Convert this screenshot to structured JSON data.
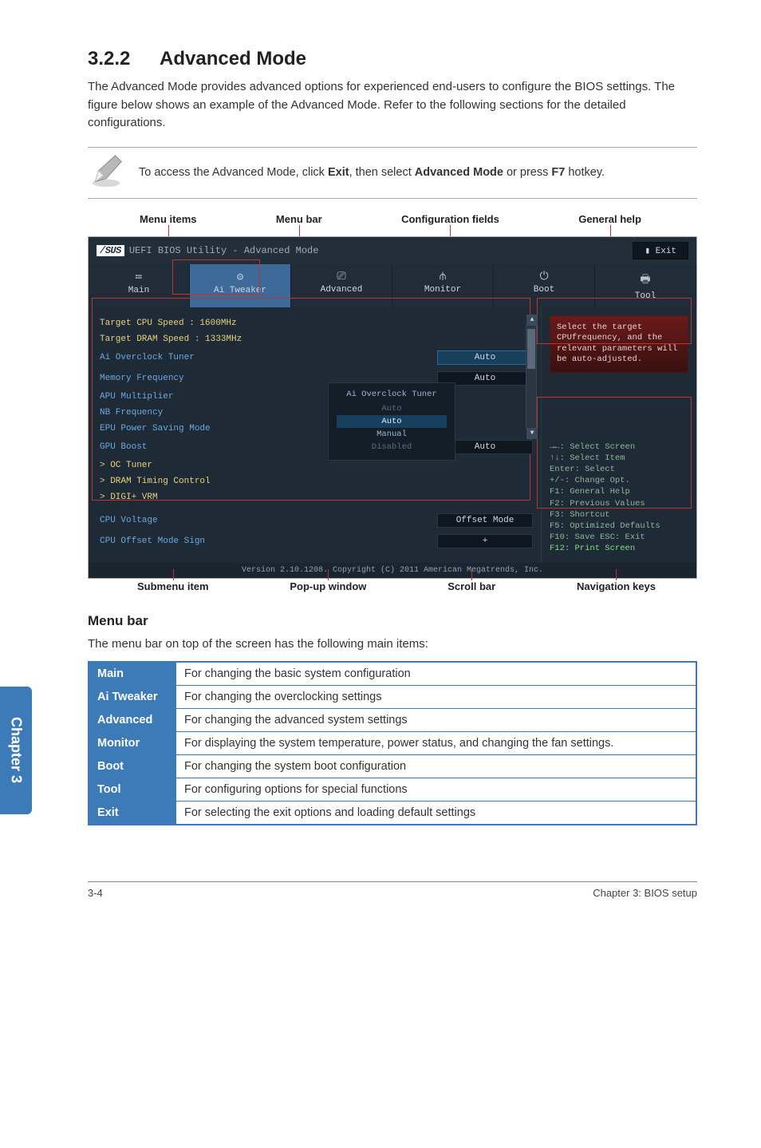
{
  "doc": {
    "section_number": "3.2.2",
    "section_title": "Advanced Mode",
    "intro": "The Advanced Mode provides advanced options for experienced end-users to configure the BIOS settings. The figure below shows an example of the Advanced Mode. Refer to the following sections for the detailed configurations.",
    "note_prefix": "To access the Advanced Mode, click ",
    "note_b1": "Exit",
    "note_mid": ", then select ",
    "note_b2": "Advanced Mode",
    "note_mid2": " or press ",
    "note_b3": "F7",
    "note_suffix": " hotkey."
  },
  "callouts_top": {
    "a": "Menu items",
    "b": "Menu bar",
    "c": "Configuration fields",
    "d": "General help"
  },
  "callouts_bottom": {
    "a": "Submenu item",
    "b": "Pop-up window",
    "c": "Scroll bar",
    "d": "Navigation keys"
  },
  "bios": {
    "logo": "/SUS",
    "title": "UEFI BIOS Utility - Advanced Mode",
    "exit": "Exit",
    "tabs": {
      "main": {
        "icon": "≔",
        "label": "Main"
      },
      "tweaker": {
        "icon": "⚙",
        "label": "Ai Tweaker"
      },
      "advanced": {
        "icon": "⎚",
        "label": "Advanced"
      },
      "monitor": {
        "icon": "⫛",
        "label": "Monitor"
      },
      "boot": {
        "icon": "⏻",
        "label": "Boot"
      },
      "tool": {
        "icon": "🖶",
        "label": "Tool"
      }
    },
    "fields": {
      "target_cpu": "Target CPU Speed : 1600MHz",
      "target_dram": "Target DRAM Speed : 1333MHz",
      "ai_oc": "Ai Overclock Tuner",
      "ai_oc_val": "Auto",
      "memfreq": "Memory Frequency",
      "memfreq_val": "Auto",
      "apumult": "APU Multiplier",
      "nbfreq": "NB Frequency",
      "epu": "EPU Power Saving Mode",
      "gpu": "GPU Boost",
      "gpu_val": "Auto",
      "oc_tuner": "OC Tuner",
      "dram_timing": "DRAM Timing Control",
      "digi": "DIGI+ VRM",
      "cpu_volt": "CPU Voltage",
      "cpu_volt_val": "Offset Mode",
      "offset_sign": "CPU Offset Mode Sign",
      "offset_sign_val": "+"
    },
    "popup": {
      "title": "Ai Overclock Tuner",
      "o1": "Auto",
      "o2": "Auto",
      "o3": "Manual",
      "o4": "Disabled"
    },
    "help": "Select the target CPUfrequency, and the relevant parameters will be auto-adjusted.",
    "nav": {
      "l1": "→←: Select Screen",
      "l2": "↑↓: Select Item",
      "l3": "Enter: Select",
      "l4": "+/-: Change Opt.",
      "l5": "F1: General Help",
      "l6": "F2: Previous Values",
      "l7": "F3: Shortcut",
      "l8": "F5: Optimized Defaults",
      "l9": "F10: Save  ESC: Exit",
      "l10": "F12: Print Screen"
    },
    "footer": "Version 2.10.1208. Copyright (C) 2011 American Megatrends, Inc."
  },
  "menubar_section": {
    "heading": "Menu bar",
    "intro": "The menu bar on top of the screen has the following main items:"
  },
  "menu_table": {
    "main": {
      "name": "Main",
      "desc": "For changing the basic system configuration"
    },
    "tweaker": {
      "name": "Ai Tweaker",
      "desc": "For changing the overclocking settings"
    },
    "advanced": {
      "name": "Advanced",
      "desc": "For changing the advanced system settings"
    },
    "monitor": {
      "name": "Monitor",
      "desc": "For displaying the system temperature, power status, and changing the fan settings."
    },
    "boot": {
      "name": "Boot",
      "desc": "For changing the system boot configuration"
    },
    "tool": {
      "name": "Tool",
      "desc": "For configuring options for special functions"
    },
    "exit": {
      "name": "Exit",
      "desc": "For selecting the exit options and loading default settings"
    }
  },
  "footer": {
    "page": "3-4",
    "chapter": "Chapter 3: BIOS setup"
  },
  "sidetab": "Chapter 3"
}
